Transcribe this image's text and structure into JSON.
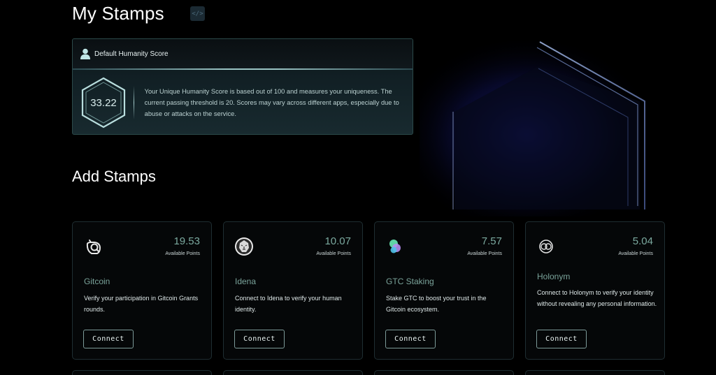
{
  "header": {
    "title": "My Stamps",
    "code_icon": "code-icon"
  },
  "score_card": {
    "title": "Default Humanity Score",
    "score": "33.22",
    "description": "Your Unique Humanity Score is based out of 100 and measures your uniqueness. The current passing threshold is 20. Scores may vary across different apps, especially due to abuse or attacks on the service."
  },
  "add_stamps": {
    "title": "Add Stamps",
    "points_label": "Available Points",
    "connect_label": "Connect",
    "cards": [
      {
        "name": "Gitcoin",
        "points": "19.53",
        "description": "Verify your participation in Gitcoin Grants rounds.",
        "icon": "gitcoin-icon"
      },
      {
        "name": "Idena",
        "points": "10.07",
        "description": "Connect to Idena to verify your human identity.",
        "icon": "idena-icon"
      },
      {
        "name": "GTC Staking",
        "points": "7.57",
        "description": "Stake GTC to boost your trust in the Gitcoin ecosystem.",
        "icon": "gtc-staking-icon"
      },
      {
        "name": "Holonym",
        "points": "5.04",
        "description": "Connect to Holonym to verify your identity without revealing any personal information.",
        "icon": "holonym-icon"
      }
    ]
  },
  "colors": {
    "background": "#000000",
    "accent": "#7ba99f",
    "card_border": "#1f2e32"
  }
}
